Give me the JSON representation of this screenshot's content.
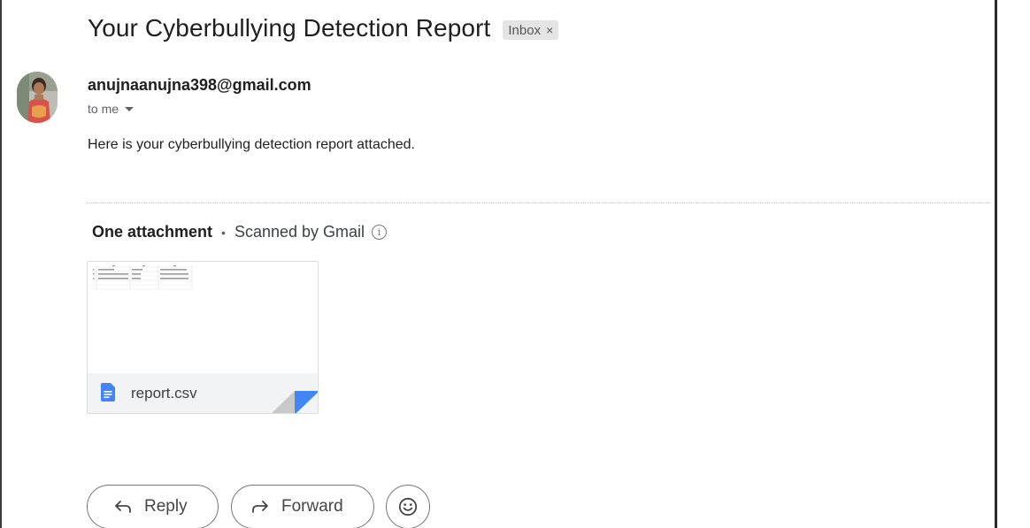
{
  "email": {
    "subject": "Your Cyberbullying Detection Report",
    "label": {
      "text": "Inbox",
      "remove_glyph": "×"
    },
    "sender": "anujnaanujna398@gmail.com",
    "recipient": "to me",
    "body": "Here is your cyberbullying detection report attached."
  },
  "attachments": {
    "count_label": "One attachment",
    "separator": "•",
    "scan_label": "Scanned by Gmail",
    "files": [
      {
        "name": "report.csv",
        "icon": "google-doc-icon",
        "icon_color": "#4285f4"
      }
    ]
  },
  "actions": {
    "reply": "Reply",
    "forward": "Forward",
    "emoji_icon": "smiley-icon"
  },
  "colors": {
    "accent_blue": "#4285f4",
    "chip_bg": "#e4e4e4",
    "text_primary": "#1f1f1f",
    "text_secondary": "#5f6368"
  }
}
